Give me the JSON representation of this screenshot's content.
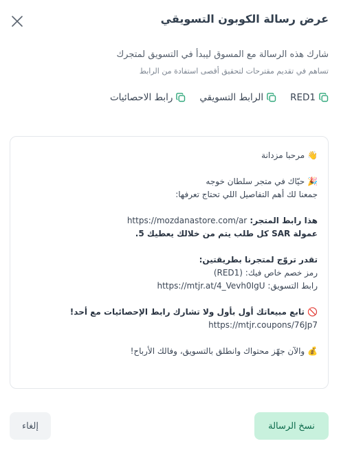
{
  "dialog": {
    "title": "عرض رسالة الكوبون التسويقي",
    "subtitle": "شارك هذه الرسالة مع المسوق ليبدأ في التسويق لمتجرك",
    "note": "تساهم في تقديم مقترحات لتحقيق أقصى استفادة من الرابط"
  },
  "copy_links": [
    {
      "label": "RED1"
    },
    {
      "label": "الرابط التسويقي"
    },
    {
      "label": "رابط الاحصائيات"
    }
  ],
  "message": {
    "greeting": "مرحبا مزدانة",
    "greeting_emoji": "👋",
    "welcome": "حيّاك في متجر سلطان خوجه",
    "welcome_emoji": "🎉",
    "intro": "جمعنا لك أهم التفاصيل اللي تحتاج تعرفها:",
    "store_link_label": "هذا رابط المتجر:",
    "store_link_url": "https://mozdanastore.com/ar",
    "commission": "عمولة SAR كل طلب يتم من خلالك يعطيك 5.",
    "promo_heading": "تقدر تروّج لمتجرنا بطريقتين:",
    "promo_code_text": "رمز خصم خاص فيك: (RED1)",
    "promo_link_label": "رابط التسويق:",
    "promo_link_url": "https://mtjr.at/4_Vevh0IgU",
    "stats_heading": "تابع مبيعاتك أول بأول ولا تشارك رابط الإحصائيات مع أحد!",
    "stats_emoji": "🚫",
    "stats_url": "https://mtjr.coupons/76Jp7",
    "closing": "والآن جهّز محتواك وانطلق بالتسويق، وفالك الأرباح!",
    "closing_emoji": "💰"
  },
  "buttons": {
    "copy_message": "نسخ الرسالة",
    "cancel": "إلغاء"
  },
  "icons": {
    "close": "close-icon",
    "copy": "copy-icon"
  },
  "colors": {
    "primary_bg": "#c8f1dd",
    "primary_text": "#0d6b4c"
  }
}
